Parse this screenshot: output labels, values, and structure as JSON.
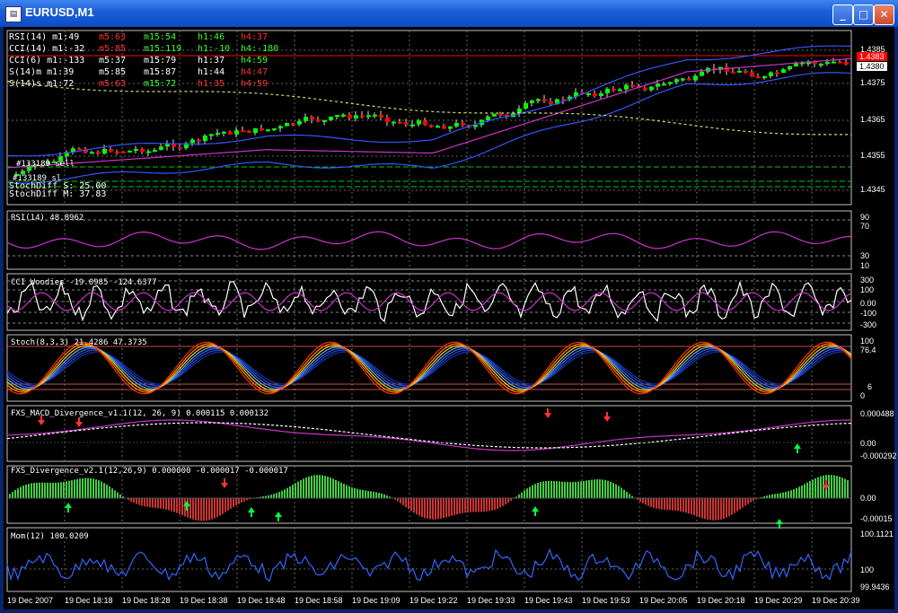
{
  "window": {
    "title": "EURUSD,M1",
    "buttons": [
      "_",
      "□",
      "✕"
    ]
  },
  "main": {
    "price_ticks": [
      "1.4385",
      "1.4375",
      "1.4365",
      "1.4355",
      "1.4345"
    ],
    "price_tags": [
      "1.4383",
      "1.4380"
    ],
    "stats": [
      [
        "RSI(14) m1:49",
        "m5:63",
        "m15:54",
        "h1:46",
        "h4:37"
      ],
      [
        "CCI(14) m1:-32",
        "m5:85",
        "m15:119",
        "h1:-10",
        "h4:-180"
      ],
      [
        "CCI(6) m1:-133",
        "m5:37",
        "m15:79",
        "h1:37",
        "h4:59"
      ],
      [
        "S(14)m m1:39",
        "m5:85",
        "m15:87",
        "h1:44",
        "h4:47"
      ],
      [
        "S(14)s m1:72",
        "m5:63",
        "m15:72",
        "h1:35",
        "h4:59"
      ]
    ],
    "order_labels": [
      "#133189 sell",
      "#133189 sl"
    ],
    "stoch_diff": [
      "StochDiff S: 25.00",
      "StochDiff M: 37.83"
    ]
  },
  "panels": {
    "rsi": {
      "label": "RSI(14) 48.8962",
      "ticks": [
        "90",
        "70",
        "30",
        "10"
      ]
    },
    "cci": {
      "label": "CCI Woodies -19.0985 -124.6377",
      "ticks": [
        "300",
        "100",
        "0.00",
        "-100",
        "-300"
      ]
    },
    "stoch": {
      "label": "Stoch(8,3,3) 21.4286 47.3735",
      "ticks": [
        "100",
        "76.4",
        "6",
        "0"
      ]
    },
    "macd": {
      "label": "FXS_MACD_Divergence_v1.1(12, 26, 9) 0.000115 0.000132",
      "ticks": [
        "0.000488",
        "0.00",
        "-0.000292"
      ]
    },
    "div": {
      "label": "FXS_Divergence_v2.1(12,26,9) 0.000000 -0.000017 -0.000017",
      "ticks": [
        "0.00",
        "-0.00015"
      ]
    },
    "mom": {
      "label": "Mom(12) 100.0209",
      "ticks": [
        "100.1121",
        "100",
        "99.9436"
      ]
    }
  },
  "time_axis": [
    "19 Dec 2007",
    "19 Dec 18:18",
    "19 Dec 18:28",
    "19 Dec 18:38",
    "19 Dec 18:48",
    "19 Dec 18:58",
    "19 Dec 19:09",
    "19 Dec 19:22",
    "19 Dec 19:33",
    "19 Dec 19:43",
    "19 Dec 19:53",
    "19 Dec 20:05",
    "19 Dec 20:18",
    "19 Dec 20:29",
    "19 Dec 20:39"
  ],
  "colors": {
    "up": "#00ff00",
    "down": "#ff0000",
    "grid": "#c0c0c0",
    "magenta": "#cc33cc",
    "blue": "#3355ff"
  }
}
